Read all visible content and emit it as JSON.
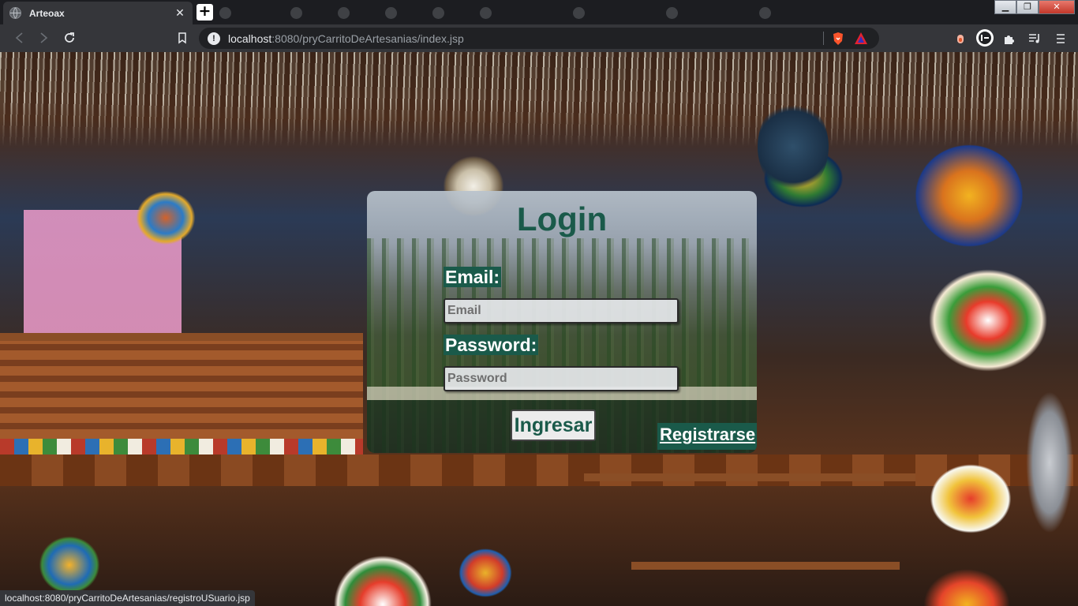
{
  "browser": {
    "active_tab": {
      "title": "Arteoax",
      "close": "✕"
    },
    "new_tab_label": "+",
    "background_tabs": [
      "",
      "",
      "",
      "",
      "",
      "",
      "",
      "",
      ""
    ],
    "url": {
      "host": "localhost",
      "path": ":8080/pryCarritoDeArtesanias/index.jsp"
    },
    "info_icon": "!",
    "window_controls": {
      "minimize": "▁",
      "restore": "❐",
      "close": "✕"
    }
  },
  "login": {
    "title": "Login",
    "email_label": "Email:",
    "email_placeholder": "Email",
    "password_label": "Password:",
    "password_placeholder": "Password",
    "submit_label": "Ingresar",
    "register_link": "Registrarse"
  },
  "status_bar": {
    "text": "localhost:8080/pryCarritoDeArtesanias/registroUSuario.jsp"
  },
  "colors": {
    "accent": "#1a5a4a",
    "chrome": "#35363a",
    "tabbar": "#1c1d21"
  }
}
